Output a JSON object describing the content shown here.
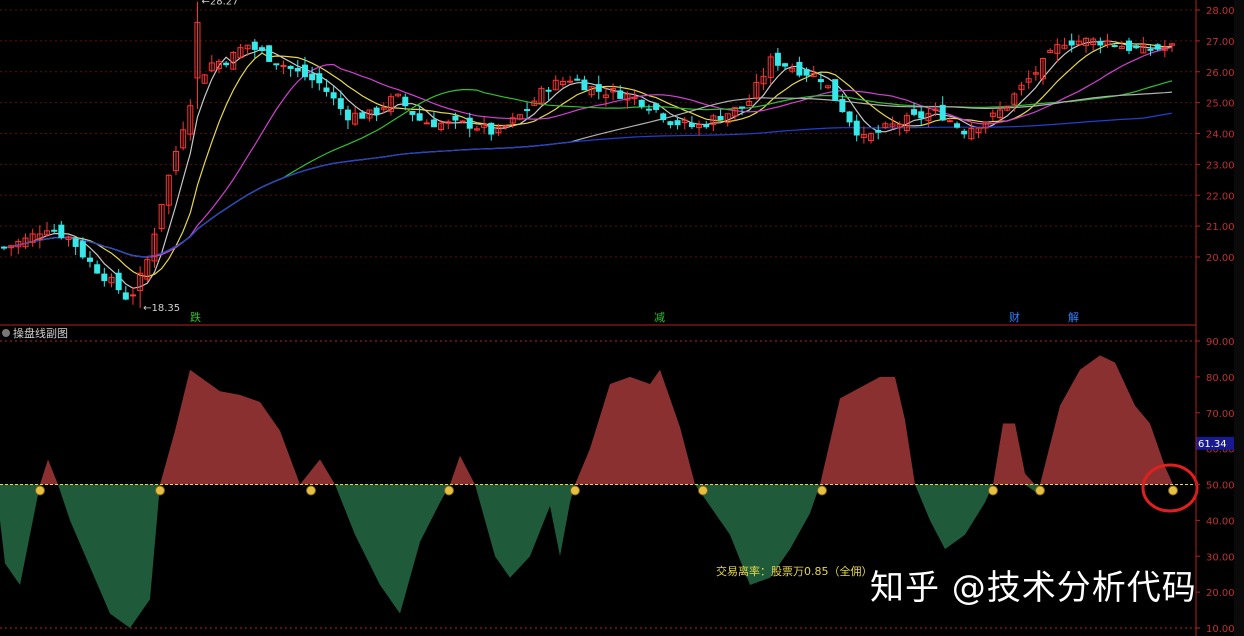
{
  "chart_data": [
    {
      "type": "candlestick",
      "name_note": "Main price chart with moving averages",
      "y_axis_ticks": [
        "28.00",
        "27.00",
        "26.00",
        "25.00",
        "24.00",
        "23.00",
        "22.00",
        "21.00",
        "20.00"
      ],
      "ylim": [
        19.0,
        28.4
      ],
      "annotations": {
        "high": "28.27",
        "low": "18.35"
      },
      "event_markers": [
        "跌",
        "减",
        "财",
        "解"
      ],
      "colors": {
        "up": "#ff3333",
        "down": "#38e8e8",
        "ma_white": "#c8c8c8",
        "ma_yellow": "#e6d84a",
        "ma_magenta": "#d040d0",
        "ma_green": "#30c030",
        "ma_gray": "#b0b0b0",
        "ma_blue": "#2040d0"
      }
    },
    {
      "type": "area",
      "title": "操盘线副图",
      "y_axis_ticks": [
        "90.00",
        "80.00",
        "70.00",
        "60.00",
        "50.00",
        "40.00",
        "30.00",
        "20.00",
        "10.00"
      ],
      "ylim": [
        10,
        90
      ],
      "baseline": 50,
      "current_value": "61.34",
      "note": "交易离率：股票万0.85（全佣）",
      "colors": {
        "above": "#8b3030",
        "below": "#1f5a3a",
        "baseline": "#e6d84a"
      }
    }
  ],
  "watermark": "知乎 @技术分析代码"
}
